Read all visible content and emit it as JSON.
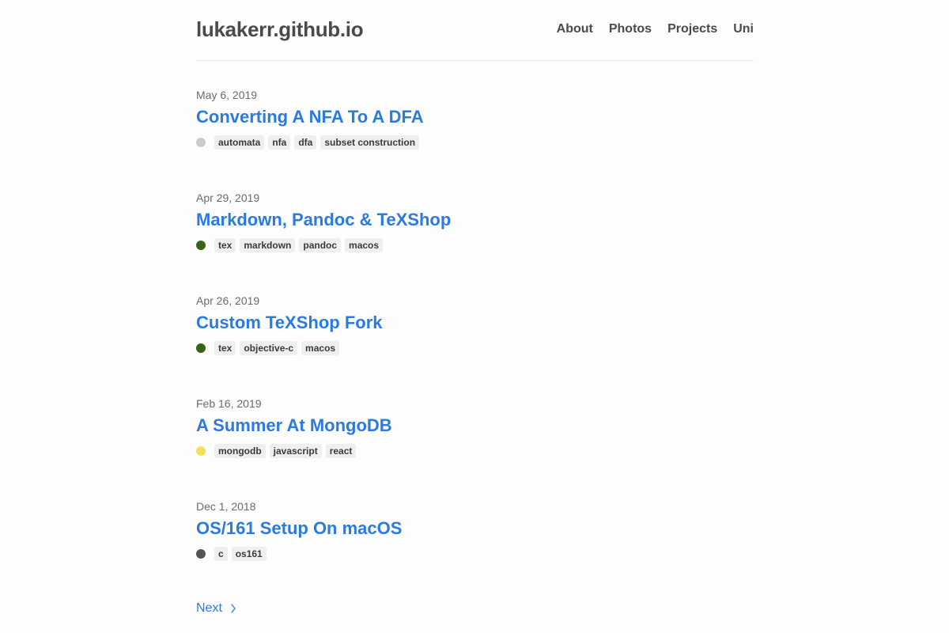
{
  "site": {
    "title": "lukakerr.github.io"
  },
  "nav": {
    "items": [
      {
        "label": "About"
      },
      {
        "label": "Photos"
      },
      {
        "label": "Projects"
      },
      {
        "label": "Uni"
      }
    ]
  },
  "posts": [
    {
      "date": "May 6, 2019",
      "title": "Converting A NFA To A DFA",
      "lang_color": "#cccccc",
      "tags": [
        "automata",
        "nfa",
        "dfa",
        "subset construction"
      ]
    },
    {
      "date": "Apr 29, 2019",
      "title": "Markdown, Pandoc & TeXShop",
      "lang_color": "#3d6117",
      "tags": [
        "tex",
        "markdown",
        "pandoc",
        "macos"
      ]
    },
    {
      "date": "Apr 26, 2019",
      "title": "Custom TeXShop Fork",
      "lang_color": "#3d6117",
      "tags": [
        "tex",
        "objective-c",
        "macos"
      ]
    },
    {
      "date": "Feb 16, 2019",
      "title": "A Summer At MongoDB",
      "lang_color": "#f1e05a",
      "tags": [
        "mongodb",
        "javascript",
        "react"
      ]
    },
    {
      "date": "Dec 1, 2018",
      "title": "OS/161 Setup On macOS",
      "lang_color": "#555555",
      "tags": [
        "c",
        "os161"
      ]
    }
  ],
  "pagination": {
    "next_label": "Next",
    "arrow_icon": "chevron-right-icon"
  },
  "colors": {
    "link": "#2a7ae2",
    "text": "#4a4a4a",
    "tag_bg": "#efefef"
  }
}
